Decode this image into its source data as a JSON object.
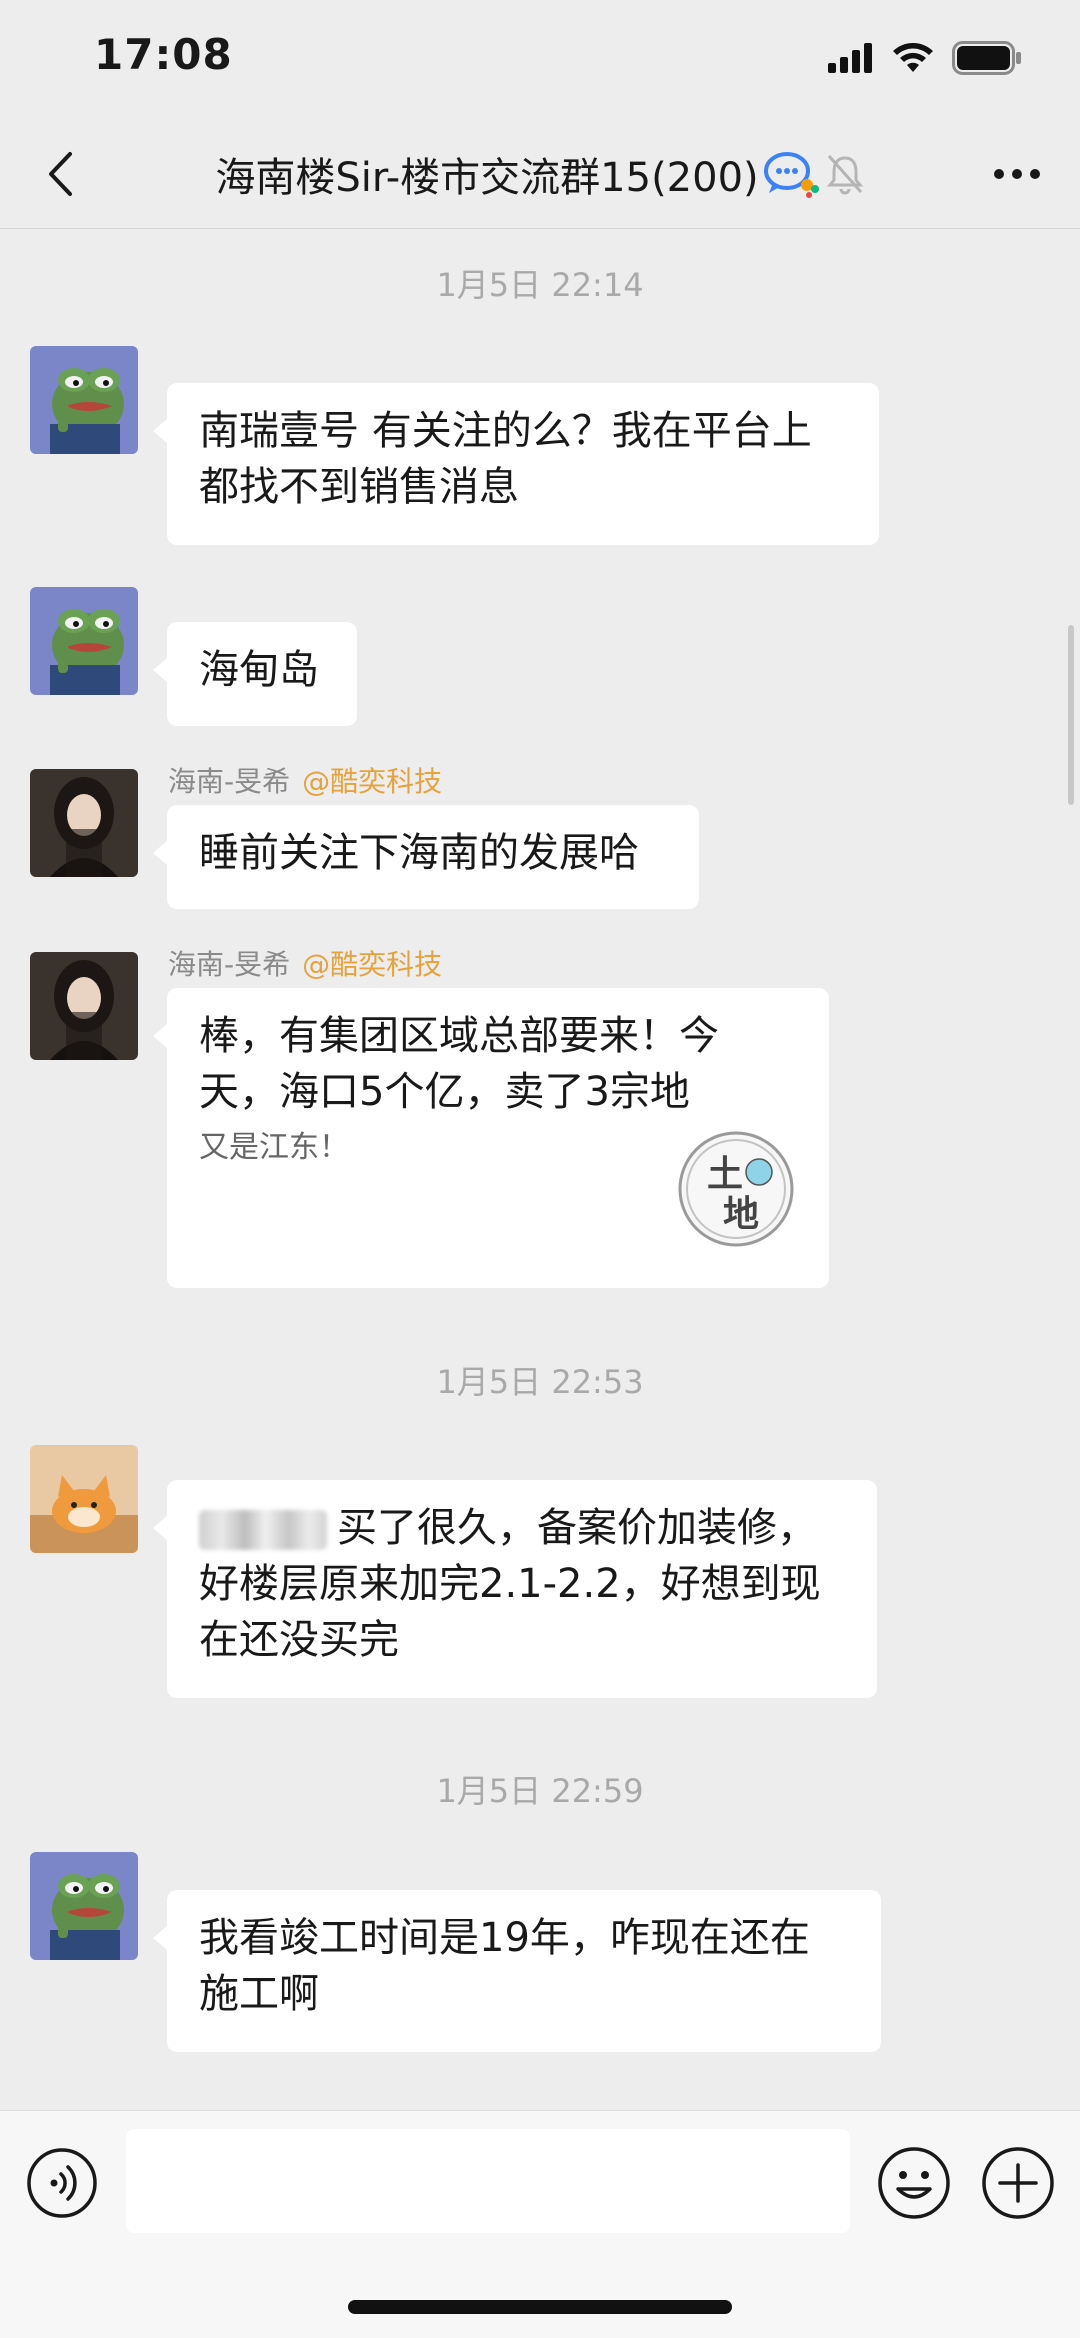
{
  "status_bar": {
    "time": "17:08"
  },
  "nav": {
    "title": "海南楼Sir-楼市交流群15(200)"
  },
  "messages": {
    "t1": "1月5日 22:14",
    "m1": {
      "line1": "南瑞壹号 有关注的么？我在平台上",
      "line2": "都找不到销售消息"
    },
    "m2": {
      "text": "海甸岛"
    },
    "m3": {
      "sender": "海南-旻希",
      "mention": "@酷奕科技",
      "text": "睡前关注下海南的发展哈"
    },
    "m4": {
      "sender": "海南-旻希",
      "mention": "@酷奕科技",
      "line1": "棒，有集团区域总部要来！今",
      "line2": "天，海口5个亿，卖了3宗地",
      "sub": "又是江东！",
      "stamp_top": "土",
      "stamp_bottom": "地"
    },
    "t2": "1月5日 22:53",
    "m5": {
      "line1": "买了很久，备案价加装修，",
      "line2": "好楼层原来加完2.1-2.2，好想到现",
      "line3": "在还没买完"
    },
    "t3": "1月5日 22:59",
    "m6": {
      "line1": "我看竣工时间是19年，咋现在还在",
      "line2": "施工啊"
    }
  },
  "input": {
    "placeholder": ""
  },
  "colors": {
    "background": "#ededed",
    "bubble": "#ffffff",
    "mention": "#e6a23c",
    "timestamp": "#a9a9a9"
  },
  "icons": [
    "back-icon",
    "group-chat-icon",
    "mute-bell-icon",
    "more-icon",
    "voice-icon",
    "emoji-icon",
    "plus-icon",
    "signal-icon",
    "wifi-icon",
    "battery-icon"
  ]
}
